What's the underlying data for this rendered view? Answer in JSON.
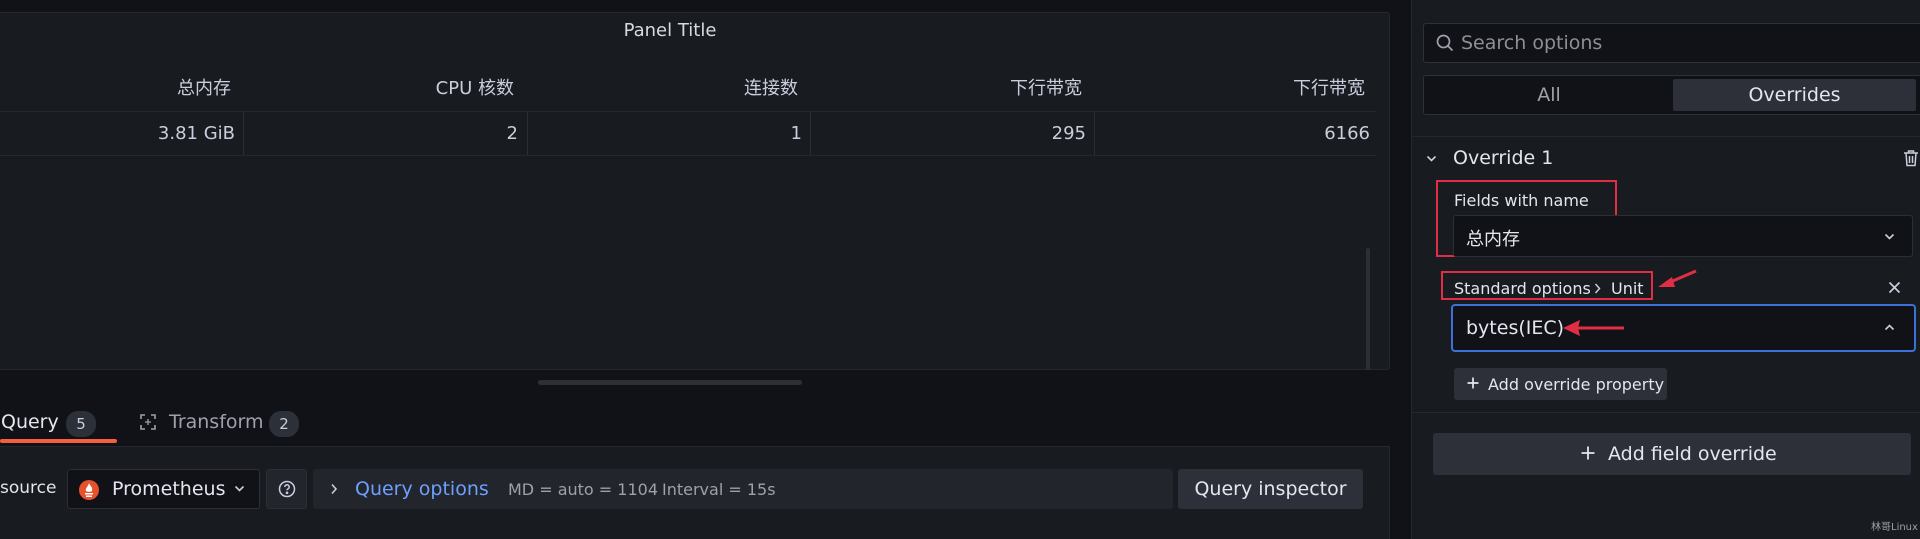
{
  "panel": {
    "title": "Panel Title",
    "columns": [
      "总内存",
      "CPU 核数",
      "连接数",
      "下行带宽",
      "下行带宽"
    ],
    "row": [
      "3.81 GiB",
      "2",
      "1",
      "295",
      "6166"
    ]
  },
  "tabs": [
    {
      "label": "Query",
      "count": "5",
      "active": true
    },
    {
      "label": "Transform",
      "count": "2",
      "active": false
    }
  ],
  "query_bar": {
    "data_source_label": "source",
    "data_source": "Prometheus",
    "query_options_label": "Query options",
    "md": "MD = auto = 1104",
    "interval": "Interval = 15s",
    "inspector_label": "Query inspector"
  },
  "sidebar": {
    "search_placeholder": "Search options",
    "segments": [
      "All",
      "Overrides"
    ],
    "active_segment": "Overrides",
    "override": {
      "title": "Override 1",
      "matcher_label": "Fields with name",
      "matcher_value": "总内存",
      "property_path": [
        "Standard options",
        "Unit"
      ],
      "unit_value": "bytes(IEC)",
      "add_property_label": "Add override property"
    },
    "add_field_override_label": "Add field override"
  },
  "watermark": "林哥Linux",
  "colors": {
    "accent_tab": "#f55f3e",
    "link": "#6e9fff",
    "annotation_red": "#e02f44",
    "focus_blue": "#3d71d9",
    "prometheus": "#e6522c"
  }
}
